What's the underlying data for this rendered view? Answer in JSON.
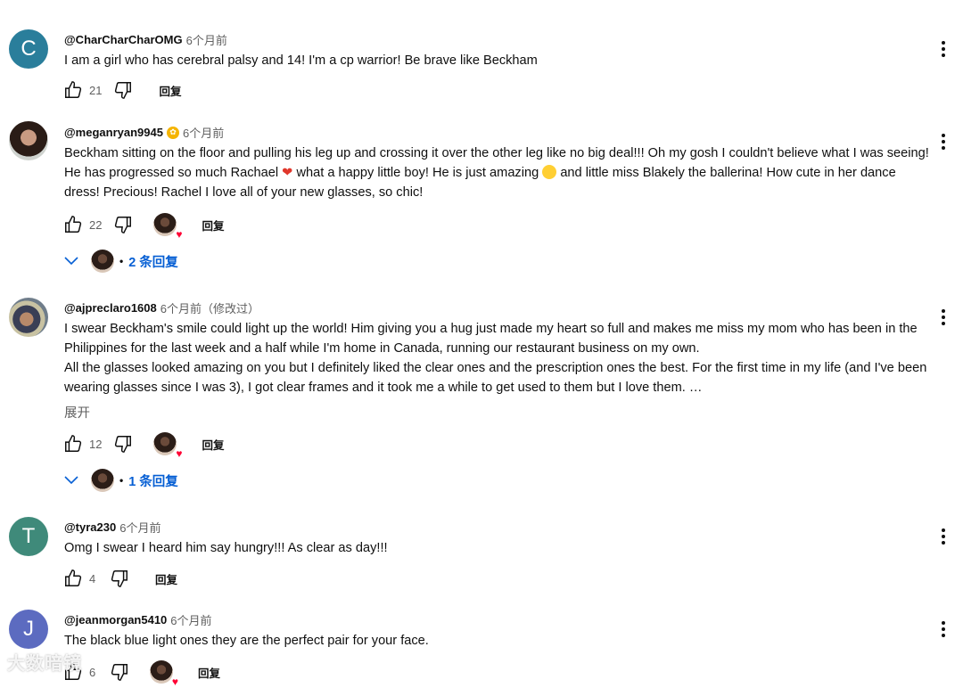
{
  "ui": {
    "reply_label": "回复",
    "expand_label": "展开",
    "reply_dot": "•"
  },
  "colors": {
    "link_blue": "#065fd4",
    "secondary_text": "#606060",
    "avatar_c": "#2a7e9b",
    "avatar_t": "#3f8a7a",
    "avatar_j": "#5c6bc0"
  },
  "comments": [
    {
      "avatar_letter": "C",
      "author": "@CharCharCharOMG",
      "time": "6个月前",
      "text": "I am a girl who has cerebral palsy and 14! I'm a cp warrior! Be brave like Beckham",
      "likes": "21"
    },
    {
      "author": "@meganryan9945",
      "time": "6个月前",
      "text_parts": [
        "Beckham sitting on the floor and pulling his leg up and crossing it over the other leg like no big deal!!! Oh my gosh I couldn't believe what I was seeing! He has progressed so much Rachael ",
        " what a happy little boy! He is just amazing ",
        " and little miss Blakely the ballerina! How cute in her dance dress! Precious! Rachel I love all of your new glasses, so chic!"
      ],
      "likes": "22",
      "replies": "2 条回复"
    },
    {
      "author": "@ajpreclaro1608",
      "time": "6个月前（修改过）",
      "paragraph1": "I swear Beckham's smile could light up the world! Him giving you a hug just made my heart so full and makes me miss my mom who has been in the Philippines for the last week and a half while I'm home in Canada, running our restaurant business on my own.",
      "paragraph2": "All the glasses looked amazing on you but I definitely liked the clear ones and the prescription ones the best. For the first time in my life (and I've been wearing glasses since I was 3), I got clear frames and it took me a while to get used to them but I love them. …",
      "likes": "12",
      "replies": "1 条回复"
    },
    {
      "avatar_letter": "T",
      "author": "@tyra230",
      "time": "6个月前",
      "text": "Omg I swear I heard him say hungry!!! As clear as day!!!",
      "likes": "4"
    },
    {
      "avatar_letter": "J",
      "author": "@jeanmorgan5410",
      "time": "6个月前",
      "text": "The black blue light ones they are the perfect pair for your face.",
      "likes": "6"
    }
  ],
  "watermark": "大数暗镜"
}
